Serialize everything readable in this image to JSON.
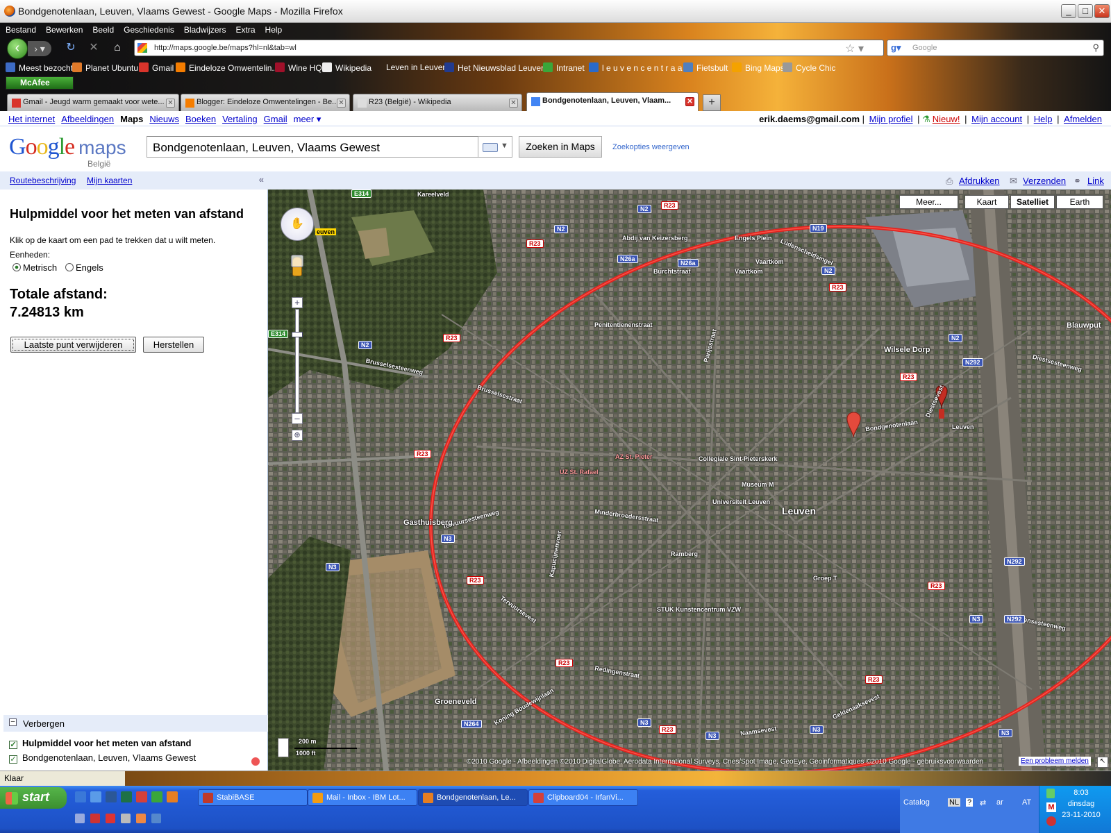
{
  "window": {
    "title": "Bondgenotenlaan, Leuven, Vlaams Gewest - Google Maps - Mozilla Firefox",
    "controls": {
      "minimize": "_",
      "maximize": "□",
      "close": "✕"
    }
  },
  "menubar": [
    "Bestand",
    "Bewerken",
    "Beeld",
    "Geschiedenis",
    "Bladwijzers",
    "Extra",
    "Help"
  ],
  "navbar": {
    "url": "http://maps.google.be/maps?hl=nl&tab=wl",
    "search_placeholder": "Google"
  },
  "bookmarks": [
    {
      "label": "Meest bezocht",
      "color": "#3d6bc5"
    },
    {
      "label": "Planet Ubuntu",
      "color": "#e07a2a"
    },
    {
      "label": "Gmail",
      "color": "#d9342b"
    },
    {
      "label": "Eindeloze Omwentelin...",
      "color": "#f57d00"
    },
    {
      "label": "Wine HQ",
      "color": "#a0102a"
    },
    {
      "label": "Wikipedia",
      "color": "#eeeeee"
    },
    {
      "label": "Leven in Leuven",
      "color": ""
    },
    {
      "label": "Het Nieuwsblad Leuven",
      "color": "#223b8f"
    },
    {
      "label": "Intranet",
      "color": "#3aa63a"
    },
    {
      "label": "l e u v e n c e n t r a a l",
      "color": "#2a6acb"
    },
    {
      "label": "Fietsbult",
      "color": "#4f7fbf"
    },
    {
      "label": "Bing Maps",
      "color": "#f4a200"
    },
    {
      "label": "Cycle Chic",
      "color": "#999999"
    }
  ],
  "mcafee": "McAfee",
  "tabs": [
    {
      "label": "Gmail - Jeugd warm gemaakt voor wete...",
      "icon_color": "#d9342b",
      "active": false
    },
    {
      "label": "Blogger: Eindeloze Omwentelingen - Be...",
      "icon_color": "#f57d00",
      "active": false
    },
    {
      "label": "R23 (België) - Wikipedia",
      "icon_color": "#dddddd",
      "active": false
    },
    {
      "label": "Bondgenotenlaan, Leuven, Vlaam...",
      "icon_color": "#4285f4",
      "active": true
    }
  ],
  "gbar": {
    "links": [
      "Het internet",
      "Afbeeldingen",
      "Maps",
      "Nieuws",
      "Boeken",
      "Vertaling",
      "Gmail",
      "meer ▾"
    ],
    "active": "Maps",
    "email": "erik.daems@gmail.com",
    "right_links": [
      "Mijn profiel",
      "Nieuw!",
      "Mijn account",
      "Help",
      "Afmelden"
    ]
  },
  "search": {
    "logo_country": "België",
    "query": "Bondgenotenlaan, Leuven, Vlaams Gewest",
    "button": "Zoeken in Maps",
    "options": "Zoekopties weergeven"
  },
  "sidebar": {
    "links": [
      "Routebeschrijving",
      "Mijn kaarten"
    ],
    "collapse": "«",
    "title": "Hulpmiddel voor het meten van afstand",
    "instruction": "Klik op de kaart om een pad te trekken dat u wilt meten.",
    "units_label": "Eenheden:",
    "units": [
      {
        "label": "Metrisch",
        "selected": true
      },
      {
        "label": "Engels",
        "selected": false
      }
    ],
    "total_label": "Totale afstand:",
    "total_value": "7.24813 km",
    "btn_remove": "Laatste punt verwijderen",
    "btn_reset": "Herstellen",
    "hide_label": "Verbergen",
    "layers": [
      "Hulpmiddel voor het meten van afstand",
      "Bondgenotenlaan, Leuven, Vlaams Gewest"
    ]
  },
  "maptoolbar": {
    "print": "Afdrukken",
    "send": "Verzenden",
    "link": "Link"
  },
  "map": {
    "types": [
      {
        "label": "Meer...",
        "selected": false
      },
      {
        "label": "Kaart",
        "selected": false
      },
      {
        "label": "Satelliet",
        "selected": true
      },
      {
        "label": "Earth",
        "selected": false
      }
    ],
    "ring_color": "#e3231f",
    "scale_m": "200 m",
    "scale_ft": "1000 ft",
    "copyright": "©2010 Google - Afbeeldingen ©2010 DigitalGlobe, Aerodata International Surveys, Cnes/Spot Image, GeoEye, Geoinformatiques ©2010 Google - gebruiksvoorwaarden",
    "report": "Een probleem melden",
    "labels": [
      "Kareelveld",
      "E314",
      "euven",
      "Abdij van Keizersberg",
      "Engels Plein",
      "Ludenscheidsingel",
      "Vaartkom",
      "Burchtstraat",
      "Vaartkom",
      "Penitentienenstraat",
      "Parijsstraat",
      "Blauwput",
      "Wilsele Dorp",
      "Diestsesteenweg",
      "Brusselsesteenweg",
      "Tervuursesteenweg",
      "Leuven",
      "Universiteit Leuven",
      "Museum M",
      "Collegiale Sint-Pieterskerk",
      "AZ St. Pieter",
      "UZ St. Rafael",
      "Gasthuisberg",
      "STUK Kunstencentrum VZW",
      "Groeneveld",
      "Koning Boudewijnlaan",
      "Naamsevest",
      "Geldenaaksevest",
      "Tiensesteenweg",
      "Bondgenotenlaan",
      "Redingenstraat",
      "Diestsevest",
      "Tervuursevest",
      "Leuven",
      "Groep T",
      "Ramberg",
      "Minderbroedersstraat",
      "Kapucijnenvoer",
      "Brusselsestraat"
    ],
    "shields": [
      "N2",
      "R23",
      "N19",
      "N26a",
      "N26a",
      "N2",
      "R23",
      "N2",
      "R23",
      "E314",
      "N2",
      "R23",
      "N2",
      "N292",
      "R23",
      "R23",
      "N3",
      "N3",
      "R23",
      "R23",
      "N3",
      "N292",
      "N292",
      "N3",
      "R23",
      "N3",
      "R23",
      "N3",
      "N3",
      "R23",
      "N264",
      "E314"
    ]
  },
  "statusbar": "Klaar",
  "taskbar": {
    "start": "start",
    "tasks": [
      {
        "label": "StabiBASE",
        "icon_color": "#c0392b",
        "active": false
      },
      {
        "label": "Mail - Inbox - IBM Lot...",
        "icon_color": "#f39c12",
        "active": false
      },
      {
        "label": "Bondgenotenlaan, Le...",
        "icon_color": "#e67e22",
        "active": true
      },
      {
        "label": "Clipboard04 - IrfanVi...",
        "icon_color": "#d4403a",
        "active": false
      }
    ],
    "catalog": "Catalog",
    "lang": "NL",
    "lang2": "ar",
    "lang3": "AT",
    "time": "8:03",
    "day": "dinsdag",
    "date": "23-11-2010"
  }
}
